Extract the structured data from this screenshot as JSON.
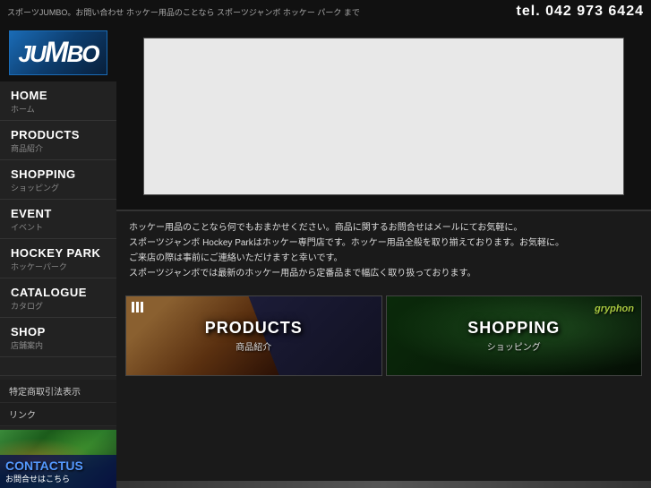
{
  "topbar": {
    "description": "スポーツJUMBO。お問い合わせ ホッケー用品のことなら スポーツジャンボ ホッケー パーク まで",
    "tel_label": "tel.",
    "tel_number": "042 973 6424"
  },
  "logo": {
    "text": "JUMBo",
    "alt": "JUMBO"
  },
  "nav": {
    "items": [
      {
        "en": "HOME",
        "jp": "ホーム"
      },
      {
        "en": "PRODUCTS",
        "jp": "商品紹介"
      },
      {
        "en": "SHOPPING",
        "jp": "ショッピング"
      },
      {
        "en": "EVENT",
        "jp": "イベント"
      },
      {
        "en": "HOCKEY PARK",
        "jp": "ホッケーパーク"
      },
      {
        "en": "CATALOGUE",
        "jp": "カタログ"
      },
      {
        "en": "SHOP",
        "jp": "店舗案内"
      }
    ],
    "links": [
      "特定商取引法表示",
      "リンク"
    ]
  },
  "contact": {
    "main": "CONTACTUS",
    "sub": "お問合せはこちら"
  },
  "hero": {
    "alt": "Hero banner image"
  },
  "body_text": {
    "lines": [
      "ホッケー用品のことなら何でもおまかせください。商品に関するお問合せはメールにてお気軽に。",
      "スポーツジャンボ Hockey Parkはホッケー専門店です。ホッケー用品全般を取り揃えております。お気軽に。",
      "ご来店の際は事前にご連絡いただけますと幸いです。",
      "スポーツジャンボでは最新のホッケー用品から定番品まで幅広く取り扱っております。"
    ]
  },
  "banners": [
    {
      "en": "PRODUCTS",
      "jp": "商品紹介",
      "brand": "adidas"
    },
    {
      "en": "SHOPPING",
      "jp": "ショッピング",
      "brand": "gryphon"
    }
  ],
  "colors": {
    "accent_blue": "#1a6bb5",
    "nav_bg": "#222222",
    "content_bg": "#1a1a1a"
  }
}
